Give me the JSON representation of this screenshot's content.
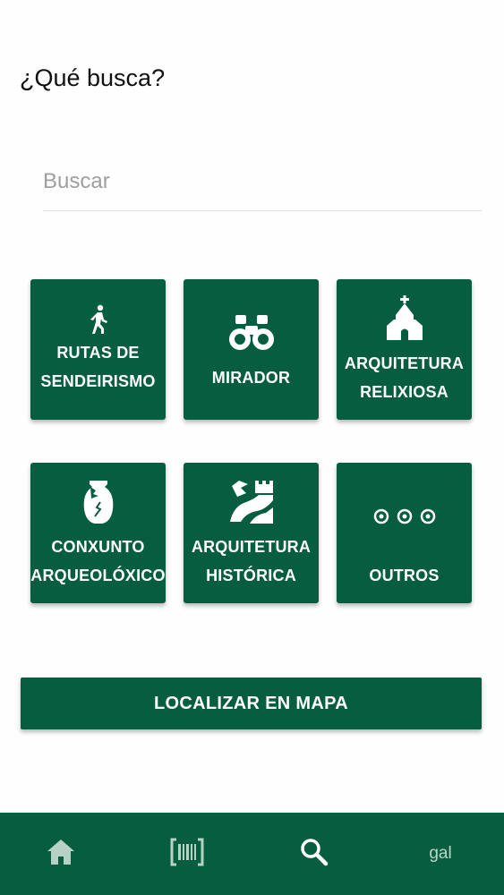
{
  "header": {
    "title": "¿Qué busca?"
  },
  "search": {
    "placeholder": "Buscar",
    "value": ""
  },
  "categories": [
    {
      "label": "RUTAS DE\nSENDEIRISMO",
      "icon": "hiker-icon"
    },
    {
      "label": "MIRADOR",
      "icon": "binoculars-icon"
    },
    {
      "label": "ARQUITETURA\nRELIXIOSA",
      "icon": "church-icon"
    },
    {
      "label": "CONXUNTO\nARQUEOLÓXICO",
      "icon": "broken-vase-icon"
    },
    {
      "label": "ARQUITETURA\nHISTÓRICA",
      "icon": "historic-wall-icon"
    },
    {
      "label": "OUTROS",
      "icon": "more-dots-icon"
    }
  ],
  "map_button": {
    "label": "LOCALIZAR EN MAPA"
  },
  "bottom_nav": {
    "items": [
      {
        "icon": "home-icon"
      },
      {
        "icon": "barcode-icon"
      },
      {
        "icon": "search-icon"
      },
      {
        "label": "gal"
      }
    ]
  },
  "colors": {
    "brand_green": "#075d40",
    "nav_icon": "#b7d1c4",
    "active_icon": "#ffffff"
  }
}
